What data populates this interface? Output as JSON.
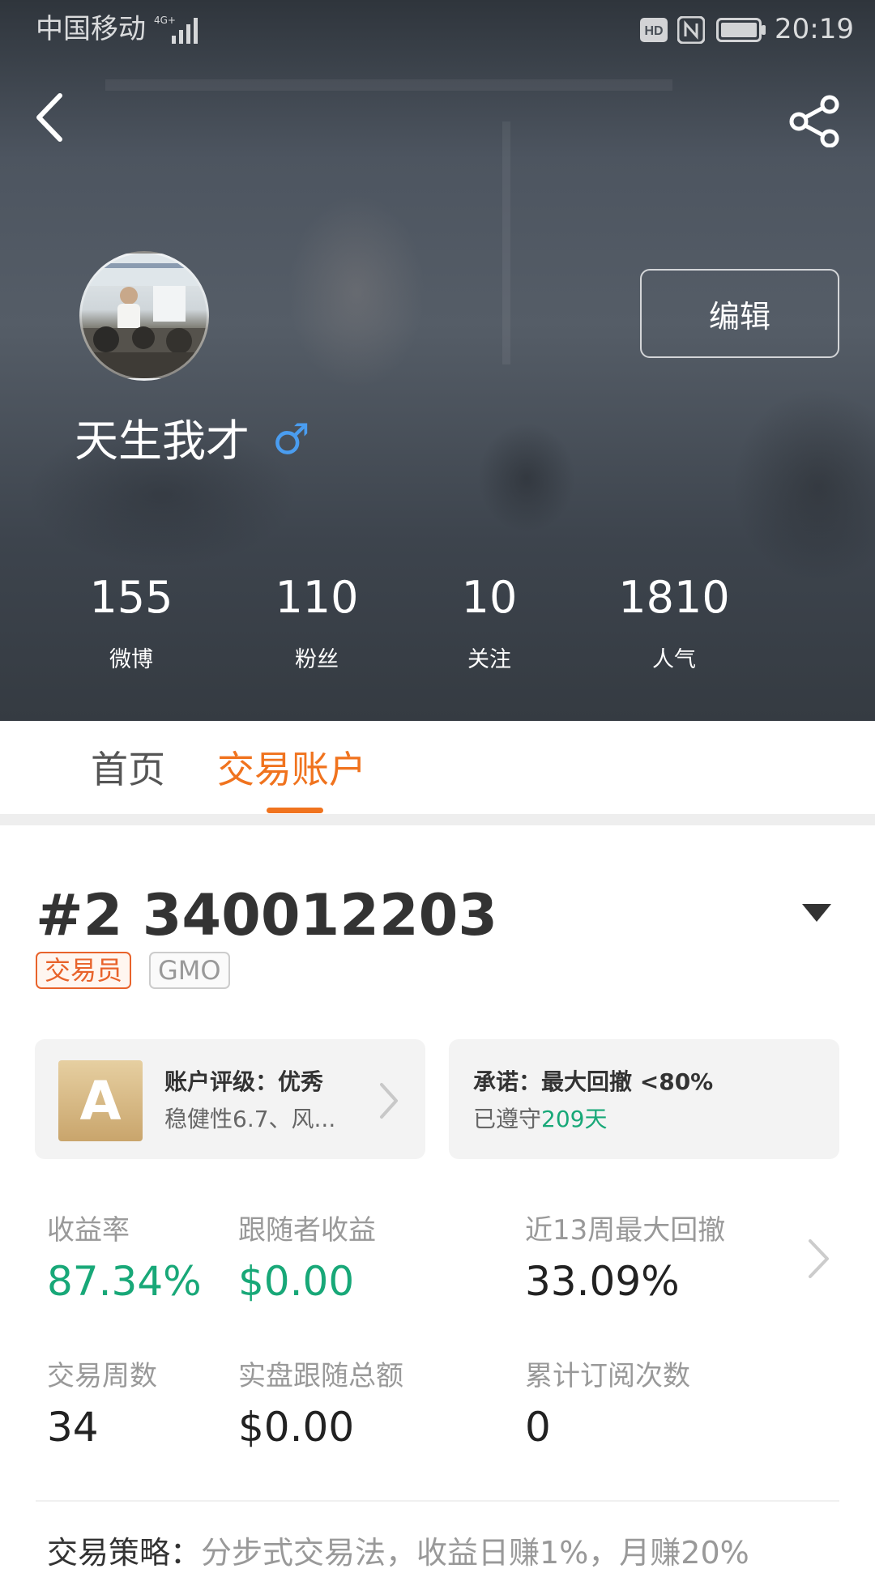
{
  "status_bar": {
    "carrier": "中国移动",
    "network": "4G+",
    "time": "20:19",
    "icons": [
      "signal-icon",
      "hd-icon",
      "nfc-icon",
      "battery-icon"
    ]
  },
  "nav": {
    "back_icon": "chevron-left-icon",
    "share_icon": "share-icon"
  },
  "profile": {
    "username": "天生我才",
    "gender_symbol": "♂",
    "edit_label": "编辑",
    "stats": [
      {
        "value": "155",
        "label": "微博"
      },
      {
        "value": "110",
        "label": "粉丝"
      },
      {
        "value": "10",
        "label": "关注"
      },
      {
        "value": "1810",
        "label": "人气"
      }
    ]
  },
  "tabs": [
    {
      "label": "首页",
      "active": false
    },
    {
      "label": "交易账户",
      "active": true
    }
  ],
  "account": {
    "title": "#2 340012203",
    "tags": [
      "交易员",
      "GMO"
    ],
    "rating_card": {
      "grade": "A",
      "title": "账户评级：优秀",
      "subtitle": "稳健性6.7、风..."
    },
    "promise_card": {
      "title": "承诺：最大回撤 <80%",
      "kept_prefix": "已遵守",
      "kept_days": "209天"
    },
    "metrics": [
      {
        "label": "收益率",
        "value": "87.34%"
      },
      {
        "label": "跟随者收益",
        "value": "$0.00"
      },
      {
        "label": "近13周最大回撤",
        "value": "33.09%"
      },
      {
        "label": "交易周数",
        "value": "34"
      },
      {
        "label": "实盘跟随总额",
        "value": "$0.00"
      },
      {
        "label": "累计订阅次数",
        "value": "0"
      }
    ],
    "strategy_label": "交易策略：",
    "strategy_value": "分步式交易法，收益日赚1%，月赚20%"
  },
  "colors": {
    "accent_orange": "#f0731e",
    "tag_orange": "#e8632b",
    "gain_green": "#18a878",
    "gender_blue": "#4a9df0"
  }
}
